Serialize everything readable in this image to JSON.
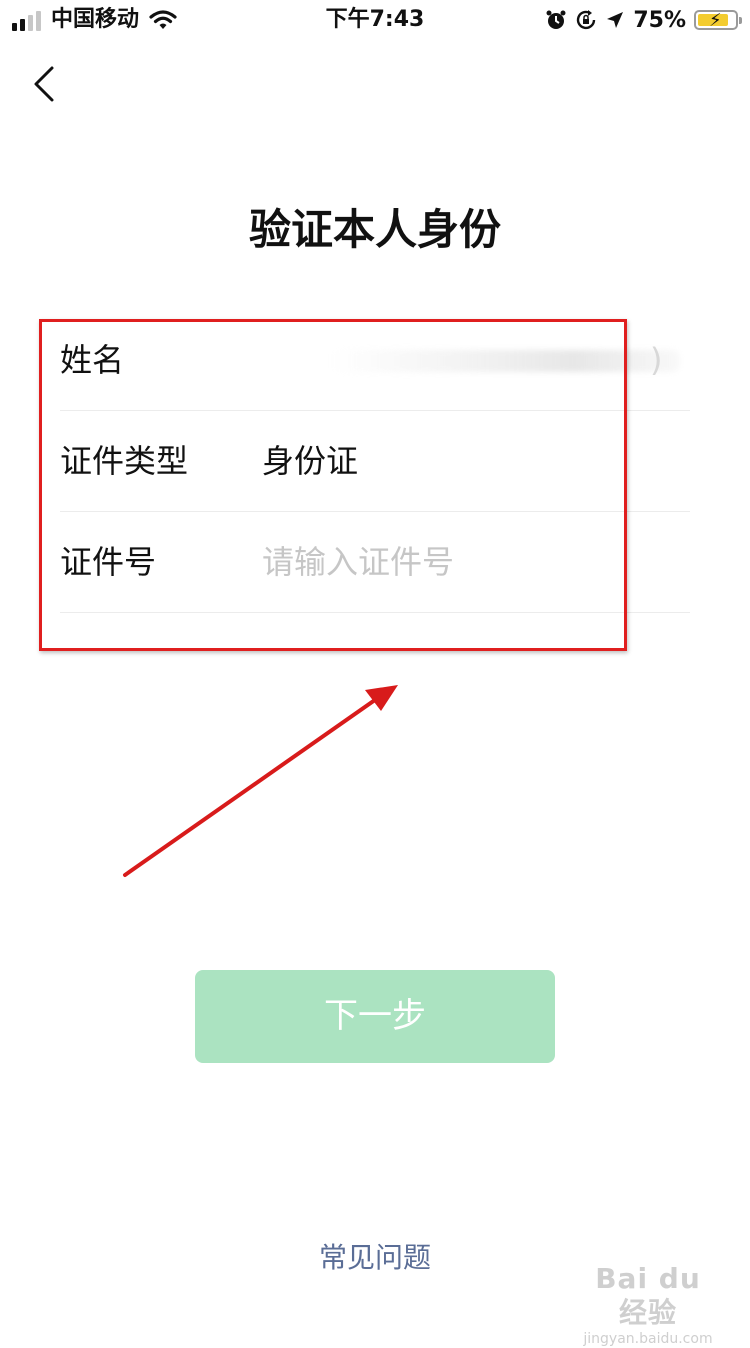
{
  "status_bar": {
    "carrier": "中国移动",
    "time": "下午7:43",
    "battery": "75%",
    "icons": [
      "signal-icon",
      "wifi-icon",
      "alarm-icon",
      "orientation-lock-icon",
      "location-icon",
      "battery-icon"
    ]
  },
  "nav": {
    "back_icon": "chevron-left-icon"
  },
  "title": "验证本人身份",
  "form": {
    "name": {
      "label": "姓名",
      "value_partial": ")"
    },
    "id_type": {
      "label": "证件类型",
      "value": "身份证"
    },
    "id_number": {
      "label": "证件号",
      "placeholder": "请输入证件号"
    }
  },
  "next_button": {
    "label": "下一步",
    "color": "#abe3c1"
  },
  "faq": {
    "label": "常见问题",
    "color": "#5a6d96"
  },
  "annotation": {
    "highlight_color": "#e01f1f"
  },
  "watermark": {
    "main": "Bai du 经验",
    "sub": "jingyan.baidu.com"
  }
}
